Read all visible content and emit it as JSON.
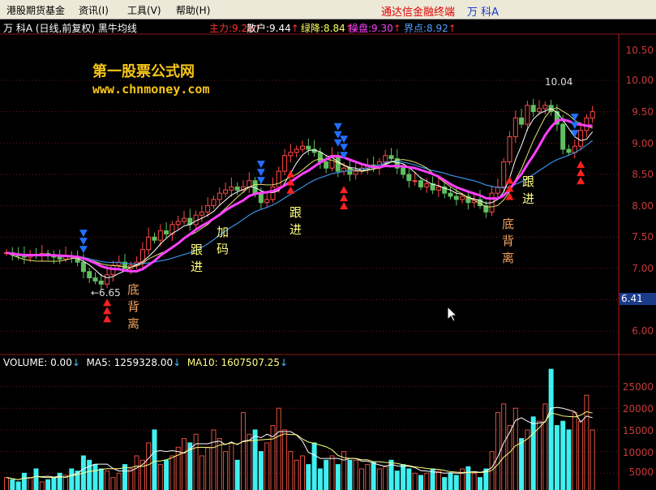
{
  "menu": {
    "items": [
      "港股期货基金",
      "资讯(I)",
      "工具(V)",
      "帮助(H)"
    ],
    "brand": "通达信金融终端",
    "stock": "万  科A"
  },
  "header": {
    "title": "万 科A (日线,前复权) 黑牛均线",
    "indicators": [
      {
        "label": "主力:",
        "value": "9.28",
        "color": "#ff3030"
      },
      {
        "label": "散户:",
        "value": "9.44",
        "color": "#ffffff"
      },
      {
        "label": "绿降:",
        "value": "8.84",
        "color": "#ffff60"
      },
      {
        "label": "操盘:",
        "value": "9.30",
        "color": "#ff40ff"
      },
      {
        "label": "界点:",
        "value": "8.92",
        "color": "#4aa0ff"
      }
    ]
  },
  "watermark": {
    "line1": "第一股票公式网",
    "line2": "www.chnmoney.com"
  },
  "annotations": {
    "high": "10.04",
    "low": "←6.65",
    "current_price": "6.41",
    "labels": [
      "底背离",
      "跟进",
      "加码",
      "跟进",
      "底背离",
      "跟进"
    ]
  },
  "price_axis": [
    "10.00",
    "9.50",
    "9.00",
    "8.50",
    "8.00",
    "7.50",
    "7.00",
    "6.00"
  ],
  "volume": {
    "header": {
      "volume": "VOLUME: 0.00",
      "ma5": "MA5: 1259328.00",
      "ma10": "MA10: 1607507.25"
    },
    "axis": [
      "25000",
      "20000",
      "15000",
      "10000",
      "5000"
    ]
  },
  "chart_data": {
    "type": "candlestick",
    "closes": [
      7.25,
      7.22,
      7.2,
      7.18,
      7.22,
      7.2,
      7.24,
      7.2,
      7.18,
      7.15,
      7.2,
      7.18,
      7.1,
      6.95,
      6.85,
      6.8,
      6.75,
      6.9,
      7.05,
      7.1,
      7.0,
      7.05,
      7.1,
      7.3,
      7.5,
      7.45,
      7.6,
      7.55,
      7.7,
      7.75,
      7.8,
      7.7,
      7.85,
      7.9,
      8.0,
      8.1,
      8.2,
      8.25,
      8.3,
      8.25,
      8.3,
      8.4,
      8.2,
      8.05,
      8.1,
      8.3,
      8.55,
      8.8,
      8.85,
      8.9,
      8.95,
      8.9,
      8.85,
      8.7,
      8.6,
      8.8,
      8.55,
      8.6,
      8.5,
      8.55,
      8.6,
      8.65,
      8.6,
      8.7,
      8.8,
      8.75,
      8.6,
      8.5,
      8.4,
      8.4,
      8.3,
      8.35,
      8.25,
      8.3,
      8.2,
      8.15,
      8.1,
      8.15,
      8.05,
      8.1,
      8.0,
      7.9,
      8.2,
      8.3,
      8.7,
      9.1,
      9.4,
      9.3,
      9.6,
      9.5,
      9.55,
      9.6,
      9.5,
      9.3,
      8.9,
      8.85,
      8.95,
      9.2,
      9.4,
      9.5
    ],
    "volumes": [
      4000,
      3500,
      3000,
      5000,
      4000,
      6000,
      3000,
      3500,
      4000,
      5000,
      4500,
      6000,
      5500,
      9000,
      8000,
      7000,
      6000,
      5500,
      4000,
      5000,
      7000,
      6000,
      9000,
      8000,
      12000,
      15000,
      7000,
      8000,
      9000,
      11000,
      13000,
      12000,
      14000,
      9000,
      11000,
      15000,
      13000,
      10000,
      12000,
      8000,
      19000,
      14000,
      15000,
      10000,
      12000,
      16000,
      20000,
      15000,
      10000,
      8000,
      9000,
      7000,
      12000,
      6000,
      8000,
      9000,
      7000,
      10000,
      8000,
      8000,
      6000,
      7000,
      7500,
      6000,
      6500,
      8000,
      5500,
      7000,
      6000,
      5000,
      4500,
      5000,
      6000,
      5500,
      4000,
      5000,
      4500,
      6000,
      6500,
      5000,
      4000,
      6000,
      10000,
      19000,
      21000,
      16000,
      20000,
      13000,
      15000,
      18000,
      17000,
      21000,
      29000,
      16000,
      17000,
      15000,
      19000,
      17000,
      23000,
      15000
    ],
    "ylim": [
      5.6,
      10.8
    ],
    "vol_ylim": [
      0,
      30000
    ],
    "sell_signals": [
      13,
      43,
      56,
      57,
      96
    ],
    "buy_signals": [
      17,
      48,
      57,
      85,
      97
    ]
  }
}
